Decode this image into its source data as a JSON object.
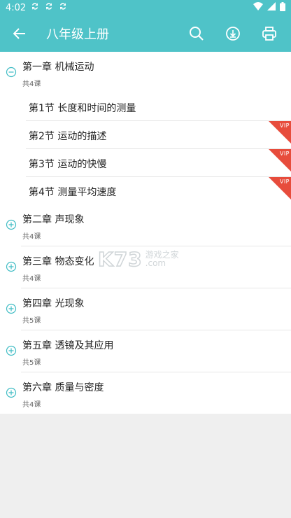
{
  "status": {
    "time": "4:02"
  },
  "header": {
    "title": "八年级上册"
  },
  "watermark": {
    "brand": "K73",
    "cn": "游戏之家",
    "domain": ".com"
  },
  "chapters": [
    {
      "name": "第一章 机械运动",
      "count": "共4课",
      "expanded": true,
      "lessons": [
        {
          "name": "第1节 长度和时间的测量",
          "vip": false
        },
        {
          "name": "第2节 运动的描述",
          "vip": true
        },
        {
          "name": "第3节 运动的快慢",
          "vip": true
        },
        {
          "name": "第4节 测量平均速度",
          "vip": true
        }
      ]
    },
    {
      "name": "第二章 声现象",
      "count": "共4课"
    },
    {
      "name": "第三章 物态变化",
      "count": "共4课"
    },
    {
      "name": "第四章 光现象",
      "count": "共5课"
    },
    {
      "name": "第五章 透镜及其应用",
      "count": "共5课"
    },
    {
      "name": "第六章 质量与密度",
      "count": "共4课"
    }
  ],
  "vip_label": "VIP",
  "colors": {
    "primary": "#4fc3c8",
    "vip": "#e74c3c",
    "toggle": "#3fbcc4"
  }
}
